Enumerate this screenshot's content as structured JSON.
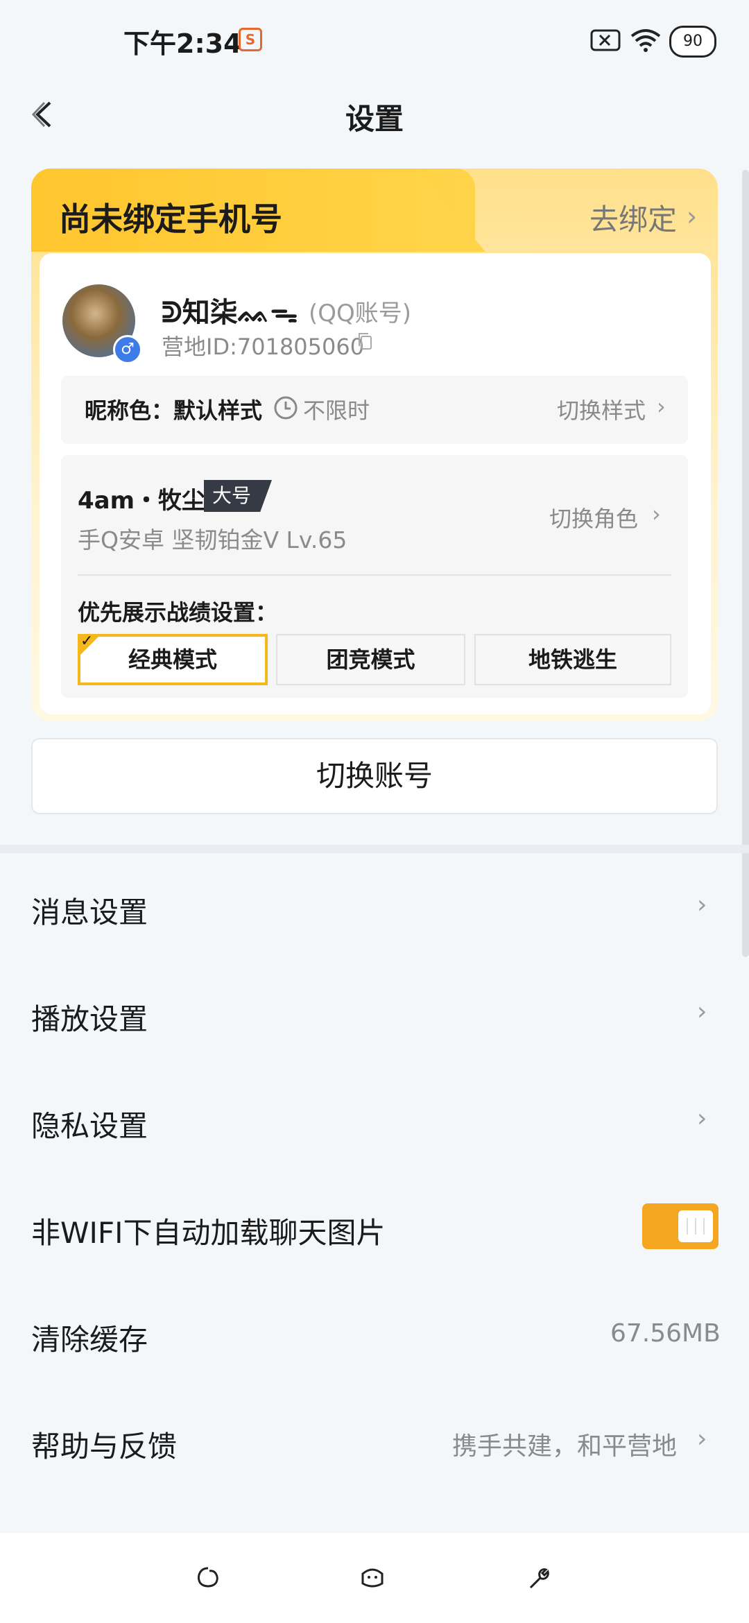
{
  "status_bar": {
    "time": "下午2:34",
    "app_badge": "S",
    "battery": "90"
  },
  "header": {
    "title": "设置"
  },
  "bind_phone": {
    "title": "尚未绑定手机号",
    "action": "去绑定"
  },
  "profile": {
    "nickname": "ᕲ知柒ᨐᯓ",
    "account_type": "(QQ账号)",
    "camp_id": "营地ID:701805060"
  },
  "nickname_color": {
    "label": "昵称色：默认样式",
    "duration": "不限时",
    "switch_label": "切换样式"
  },
  "role": {
    "name": "4am・牧尘",
    "badge": "大号",
    "info": "手Q安卓  坚韧铂金Ⅴ  Lv.65",
    "switch_label": "切换角色",
    "priority_label": "优先展示战绩设置：",
    "modes": [
      "经典模式",
      "团竞模式",
      "地铁逃生"
    ],
    "selected_mode": "经典模式"
  },
  "switch_account": "切换账号",
  "settings": {
    "message": "消息设置",
    "playback": "播放设置",
    "privacy": "隐私设置",
    "auto_load": {
      "label": "非WIFI下自动加载聊天图片",
      "enabled": true
    },
    "clear_cache": {
      "label": "清除缓存",
      "value": "67.56MB"
    },
    "help": {
      "label": "帮助与反馈",
      "value": "携手共建，和平营地"
    }
  },
  "colors": {
    "accent": "#f4a620",
    "badge_bg": "#353a45",
    "gender": "#3c7be8"
  },
  "nav_icons": [
    "circle-icon",
    "chat-face-icon",
    "wrench-icon"
  ]
}
